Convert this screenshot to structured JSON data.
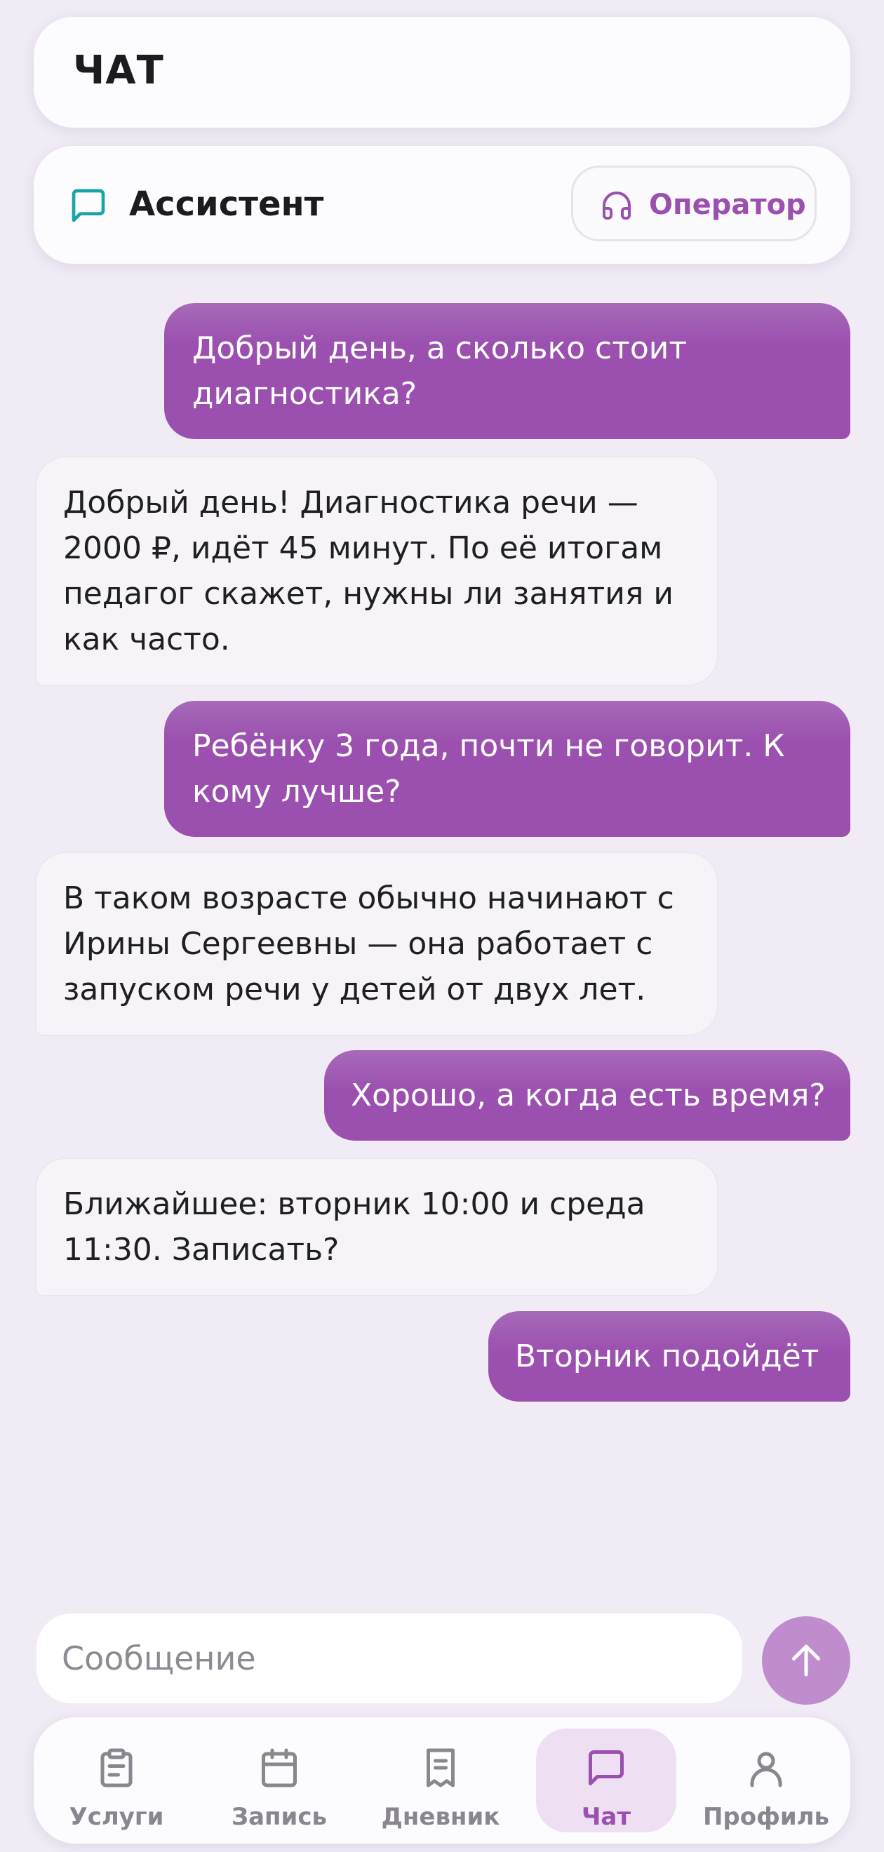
{
  "header": {
    "title": "ЧАТ"
  },
  "chat_header": {
    "assistant_label": "Ассистент",
    "operator_label": "Оператор",
    "assistant_icon": "message-square-icon",
    "operator_icon": "headphones-icon"
  },
  "messages": [
    {
      "sender": "user",
      "text": "Добрый день, а сколько стоит диагностика?"
    },
    {
      "sender": "assistant",
      "text": "Добрый день! Диагностика речи — 2000 ₽, идёт 45 минут. По её итогам педагог скажет, нужны ли занятия и как часто."
    },
    {
      "sender": "user",
      "text": "Ребёнку 3 года, почти не говорит. К кому лучше?"
    },
    {
      "sender": "assistant",
      "text": "В таком возрасте обычно начинают с Ирины Сергеевны — она работает с запуском речи у детей от двух лет."
    },
    {
      "sender": "user",
      "text": "Хорошо, а когда есть время?"
    },
    {
      "sender": "assistant",
      "text": "Ближайшее: вторник 10:00 и среда 11:30. Записать?"
    },
    {
      "sender": "user",
      "text": "Вторник подойдёт"
    }
  ],
  "composer": {
    "placeholder": "Сообщение",
    "value": "",
    "send_icon": "arrow-up-icon"
  },
  "nav": {
    "items": [
      {
        "label": "Услуги",
        "icon": "clipboard-icon",
        "active": false
      },
      {
        "label": "Запись",
        "icon": "calendar-icon",
        "active": false
      },
      {
        "label": "Дневник",
        "icon": "receipt-icon",
        "active": false
      },
      {
        "label": "Чат",
        "icon": "message-square-icon",
        "active": true
      },
      {
        "label": "Профиль",
        "icon": "user-icon",
        "active": false
      }
    ]
  },
  "colors": {
    "accent": "#9b4faf",
    "assistant_icon": "#1aa3a8",
    "background": "#f0ebf5",
    "send_button": "#bf8ccd",
    "active_nav_bg": "#efdff3"
  }
}
